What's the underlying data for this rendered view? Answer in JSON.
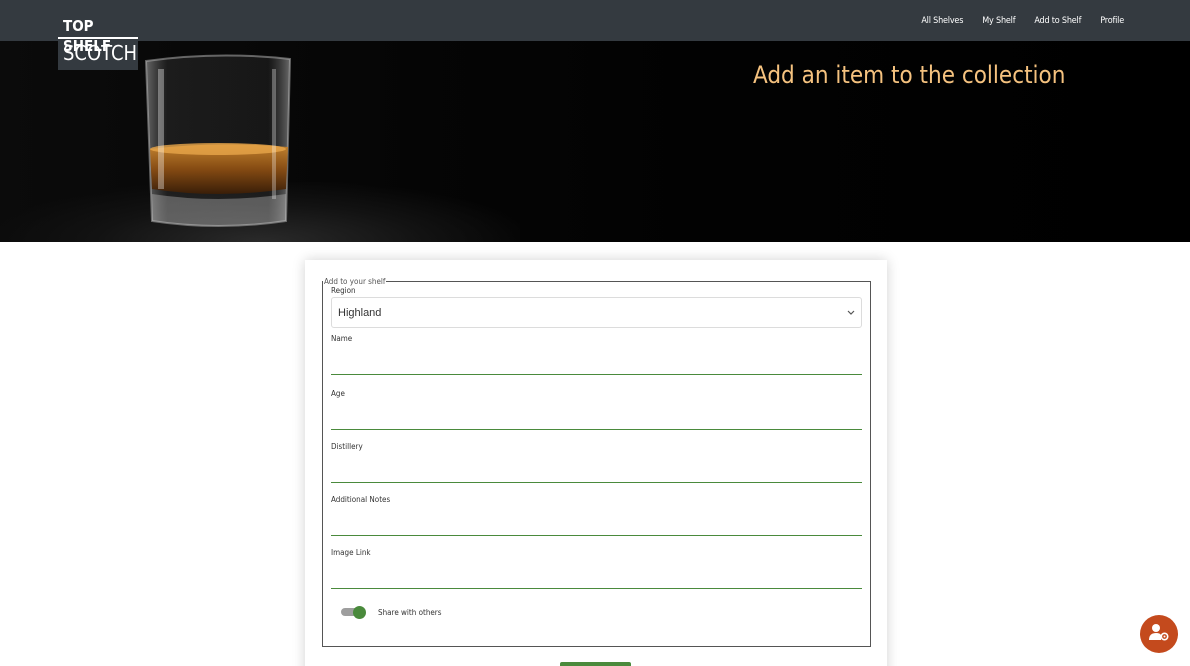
{
  "brand": {
    "line1": "TOP SHELF",
    "line2": "SCOTCH"
  },
  "nav": {
    "items": [
      "All Shelves",
      "My Shelf",
      "Add to Shelf",
      "Profile"
    ]
  },
  "hero": {
    "title": "Add an item to the collection"
  },
  "form": {
    "legend": "Add to your shelf",
    "region_label": "Region",
    "region_value": "Highland",
    "name_label": "Name",
    "age_label": "Age",
    "distillery_label": "Distillery",
    "notes_label": "Additional Notes",
    "image_label": "Image Link",
    "share_label": "Share with others",
    "share_on": true
  },
  "colors": {
    "accent_green": "#4a8a3c",
    "title_gold": "#f5c27f",
    "topbar": "#343a40",
    "fab": "#c44a1d"
  },
  "icons": {
    "fab": "user-settings-icon",
    "select": "chevron-down-icon"
  }
}
